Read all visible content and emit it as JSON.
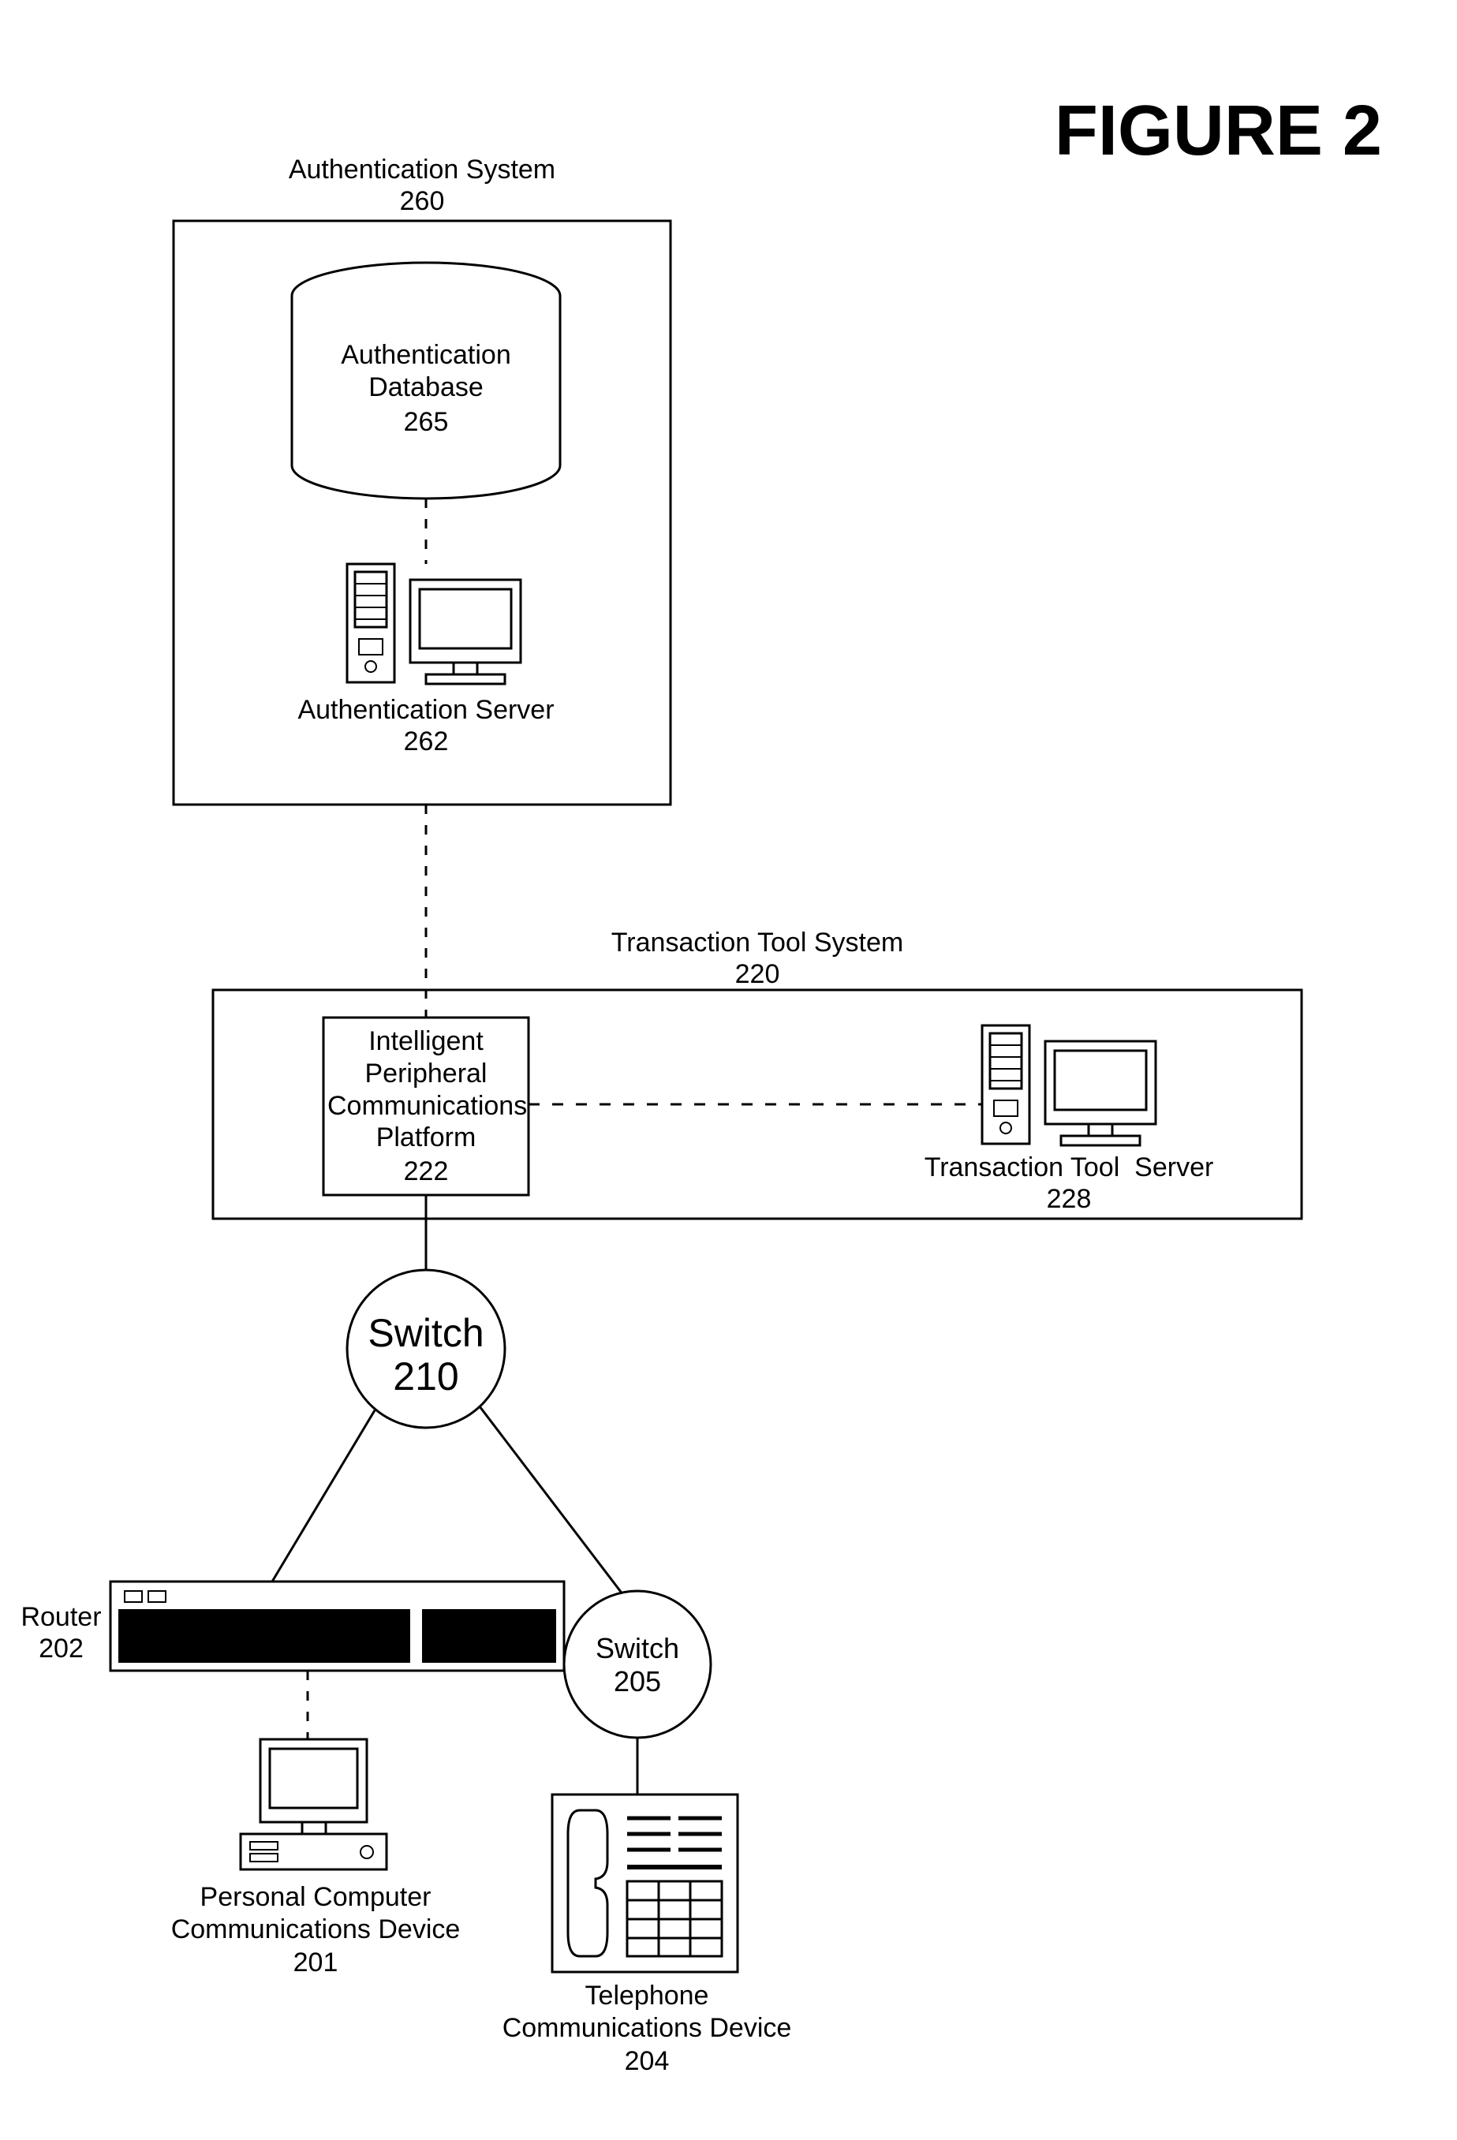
{
  "figure_title": "FIGURE 2",
  "auth_system": {
    "title": "Authentication System",
    "ref": "260"
  },
  "auth_db": {
    "title": "Authentication\nDatabase",
    "ref": "265"
  },
  "auth_server": {
    "title": "Authentication Server",
    "ref": "262"
  },
  "tx_system": {
    "title": "Transaction Tool System",
    "ref": "220"
  },
  "ipcp": {
    "title": "Intelligent\nPeripheral\nCommunications\nPlatform",
    "ref": "222"
  },
  "tx_server": {
    "title": "Transaction Tool  Server",
    "ref": "228"
  },
  "switch210": {
    "title": "Switch",
    "ref": "210"
  },
  "switch205": {
    "title": "Switch",
    "ref": "205"
  },
  "router": {
    "title": "Router",
    "ref": "202"
  },
  "pc": {
    "title": "Personal Computer\nCommunications Device",
    "ref": "201"
  },
  "phone": {
    "title": "Telephone\nCommunications Device",
    "ref": "204"
  }
}
